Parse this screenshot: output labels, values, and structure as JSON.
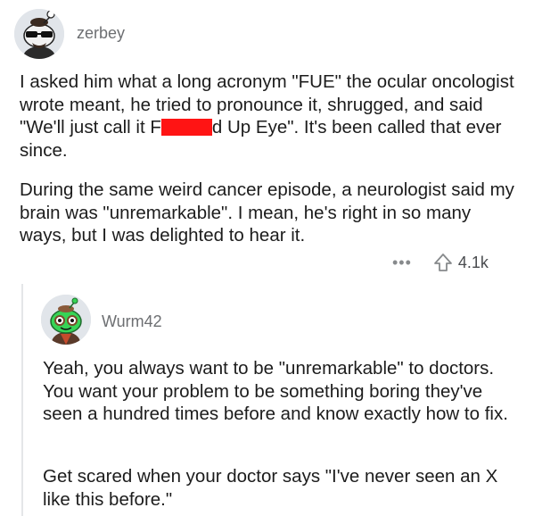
{
  "comment1": {
    "username": "zerbey",
    "para1_before": "I asked him what a long acronym \"FUE\" the ocular oncologist wrote meant, he tried to pronounce it, shrugged, and said \"We'll just call it F",
    "para1_after": "d Up Eye\".  It's been called that ever since.",
    "para2": "During the same weird cancer episode, a neurologist said my brain was \"unremarkable\".  I mean, he's right in so many ways, but I was delighted to hear it.",
    "more_label": "•••",
    "upvotes": "4.1k"
  },
  "comment2": {
    "username": "Wurm42",
    "para1": "Yeah, you always want to be \"unremarkable\" to doctors. You want your problem to be something boring they've seen a hundred times before and know exactly how to fix.",
    "para2": "Get scared when your doctor says \"I've never seen an X like this before.\""
  },
  "colors": {
    "redaction": "#ff1414",
    "muted_text": "#6d6f72",
    "thread_line": "#e4e6e8"
  }
}
